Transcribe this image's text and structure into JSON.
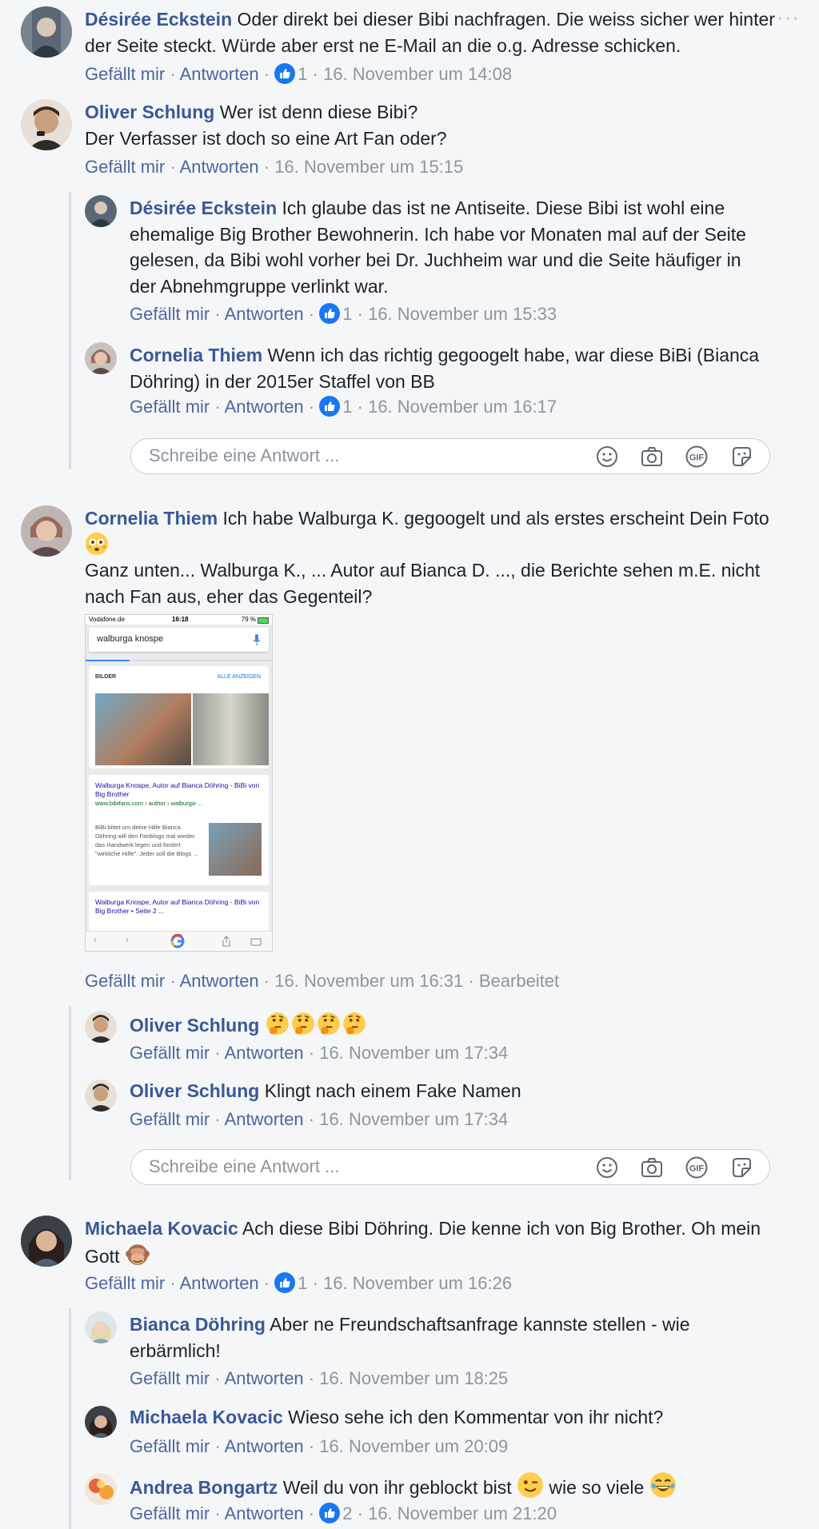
{
  "comments": [
    {
      "author": "Désirée Eckstein",
      "text": "Oder direkt bei dieser Bibi nachfragen. Die weiss sicher wer hinter der Seite steckt. Würde aber erst ne E-Mail an die o.g. Adresse schicken.",
      "like": "Gefällt mir",
      "reply": "Antworten",
      "likes": "1",
      "time": "16. November um 14:08"
    },
    {
      "author": "Oliver Schlung",
      "text": "Wer ist denn diese Bibi?",
      "text2": "Der Verfasser ist doch so eine Art Fan oder?",
      "like": "Gefällt mir",
      "reply": "Antworten",
      "time": "16. November um 15:15",
      "replies": [
        {
          "author": "Désirée Eckstein",
          "text": "Ich glaube das ist ne Antiseite. Diese Bibi ist wohl eine ehemalige Big Brother Bewohnerin. Ich habe vor Monaten mal auf der Seite gelesen, da Bibi wohl vorher bei Dr. Juchheim war und die Seite häufiger in der Abnehmgruppe verlinkt war.",
          "like": "Gefällt mir",
          "reply": "Antworten",
          "likes": "1",
          "time": "16. November um 15:33"
        },
        {
          "author": "Cornelia Thiem",
          "text": "Wenn ich das richtig gegoogelt habe, war diese BiBi (Bianca Döhring) in der 2015er Staffel von BB",
          "like": "Gefällt mir",
          "reply": "Antworten",
          "likes": "1",
          "time": "16. November um 16:17"
        }
      ]
    },
    {
      "author": "Cornelia Thiem",
      "text": "Ich habe Walburga K. gegoogelt und als erstes erscheint Dein Foto",
      "text2": "Ganz unten... Walburga K., ... Autor auf Bianca D. ..., die Berichte sehen m.E. nicht nach Fan aus, eher das Gegenteil?",
      "like": "Gefällt mir",
      "reply": "Antworten",
      "time": "16. November um 16:31",
      "edited": "Bearbeitet",
      "attachment": {
        "carrier": "Vodafone.de",
        "clock": "16:18",
        "battery": "79 %",
        "query": "walburga knospe",
        "images_label": "BILDER",
        "show_all": "ALLE ANZEIGEN",
        "result1_title": "Walburga Knospe, Autor auf Bianca Döhring - BiBi von Big Brother",
        "result1_url": "www.bibifans.com › author › walburga-...",
        "result1_snippet": "BiBi bittet um deine Hilfe Bianca Döhring will den Fanblogs mal wieder das Handwerk legen und fordert \"wirkliche Hilfe\". Jeder soll die Blogs ...",
        "result2_title": "Walburga Knospe, Autor auf Bianca Döhring - BiBi von Big Brother • Seite 2 ..."
      },
      "replies": [
        {
          "author": "Oliver Schlung",
          "text": "",
          "like": "Gefällt mir",
          "reply": "Antworten",
          "time": "16. November um 17:34"
        },
        {
          "author": "Oliver Schlung",
          "text": "Klingt nach einem Fake Namen",
          "like": "Gefällt mir",
          "reply": "Antworten",
          "time": "16. November um 17:34"
        }
      ]
    },
    {
      "author": "Michaela Kovacic",
      "text": "Ach diese Bibi Döhring. Die kenne ich von Big Brother. Oh mein Gott",
      "like": "Gefällt mir",
      "reply": "Antworten",
      "likes": "1",
      "time": "16. November um 16:26",
      "replies": [
        {
          "author": "Bianca Döhring",
          "text": "Aber ne Freundschaftsanfrage kannste stellen - wie erbärmlich!",
          "like": "Gefällt mir",
          "reply": "Antworten",
          "time": "16. November um 18:25"
        },
        {
          "author": "Michaela Kovacic",
          "text": "Wieso sehe ich den Kommentar von ihr nicht?",
          "like": "Gefällt mir",
          "reply": "Antworten",
          "time": "16. November um 20:09"
        },
        {
          "author": "Andrea Bongartz",
          "text": "Weil du von ihr geblockt bist",
          "text_after": "wie so viele",
          "like": "Gefällt mir",
          "reply": "Antworten",
          "likes": "2",
          "time": "16. November um 21:20"
        }
      ]
    }
  ],
  "reply_placeholder": "Schreibe eine Antwort ...",
  "more_menu": "···",
  "separator": "·",
  "icons": [
    "more-options-icon",
    "thumbs-up-icon",
    "emoji-icon",
    "camera-icon",
    "gif-icon",
    "sticker-icon"
  ],
  "colors": {
    "author": "#385898",
    "link": "#4b67a1",
    "meta": "#90949c",
    "like_blue": "#1877f2",
    "background": "#f5f6f7"
  }
}
